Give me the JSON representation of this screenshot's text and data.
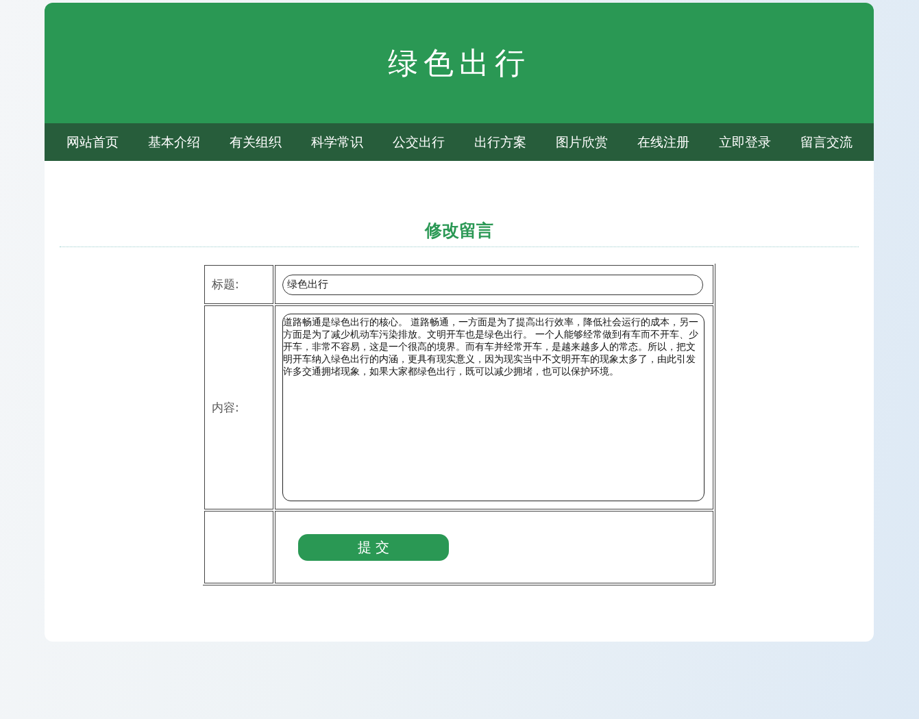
{
  "header": {
    "title": "绿色出行"
  },
  "nav": [
    {
      "label": "网站首页"
    },
    {
      "label": "基本介绍"
    },
    {
      "label": "有关组织"
    },
    {
      "label": "科学常识"
    },
    {
      "label": "公交出行"
    },
    {
      "label": "出行方案"
    },
    {
      "label": "图片欣赏"
    },
    {
      "label": "在线注册"
    },
    {
      "label": "立即登录"
    },
    {
      "label": "留言交流"
    }
  ],
  "page_title": "修改留言",
  "form": {
    "title_label": "标题:",
    "title_value": "绿色出行",
    "content_label": "内容:",
    "content_value": "道路畅通是绿色出行的核心。 道路畅通，一方面是为了提高出行效率，降低社会运行的成本，另一方面是为了减少机动车污染排放。文明开车也是绿色出行。 一个人能够经常做到有车而不开车、少开车，非常不容易，这是一个很高的境界。而有车并经常开车，是越来越多人的常态。所以，把文明开车纳入绿色出行的内涵，更具有现实意义，因为现实当中不文明开车的现象太多了，由此引发许多交通拥堵现象，如果大家都绿色出行，既可以减少拥堵，也可以保护环境。",
    "submit": "提 交"
  }
}
